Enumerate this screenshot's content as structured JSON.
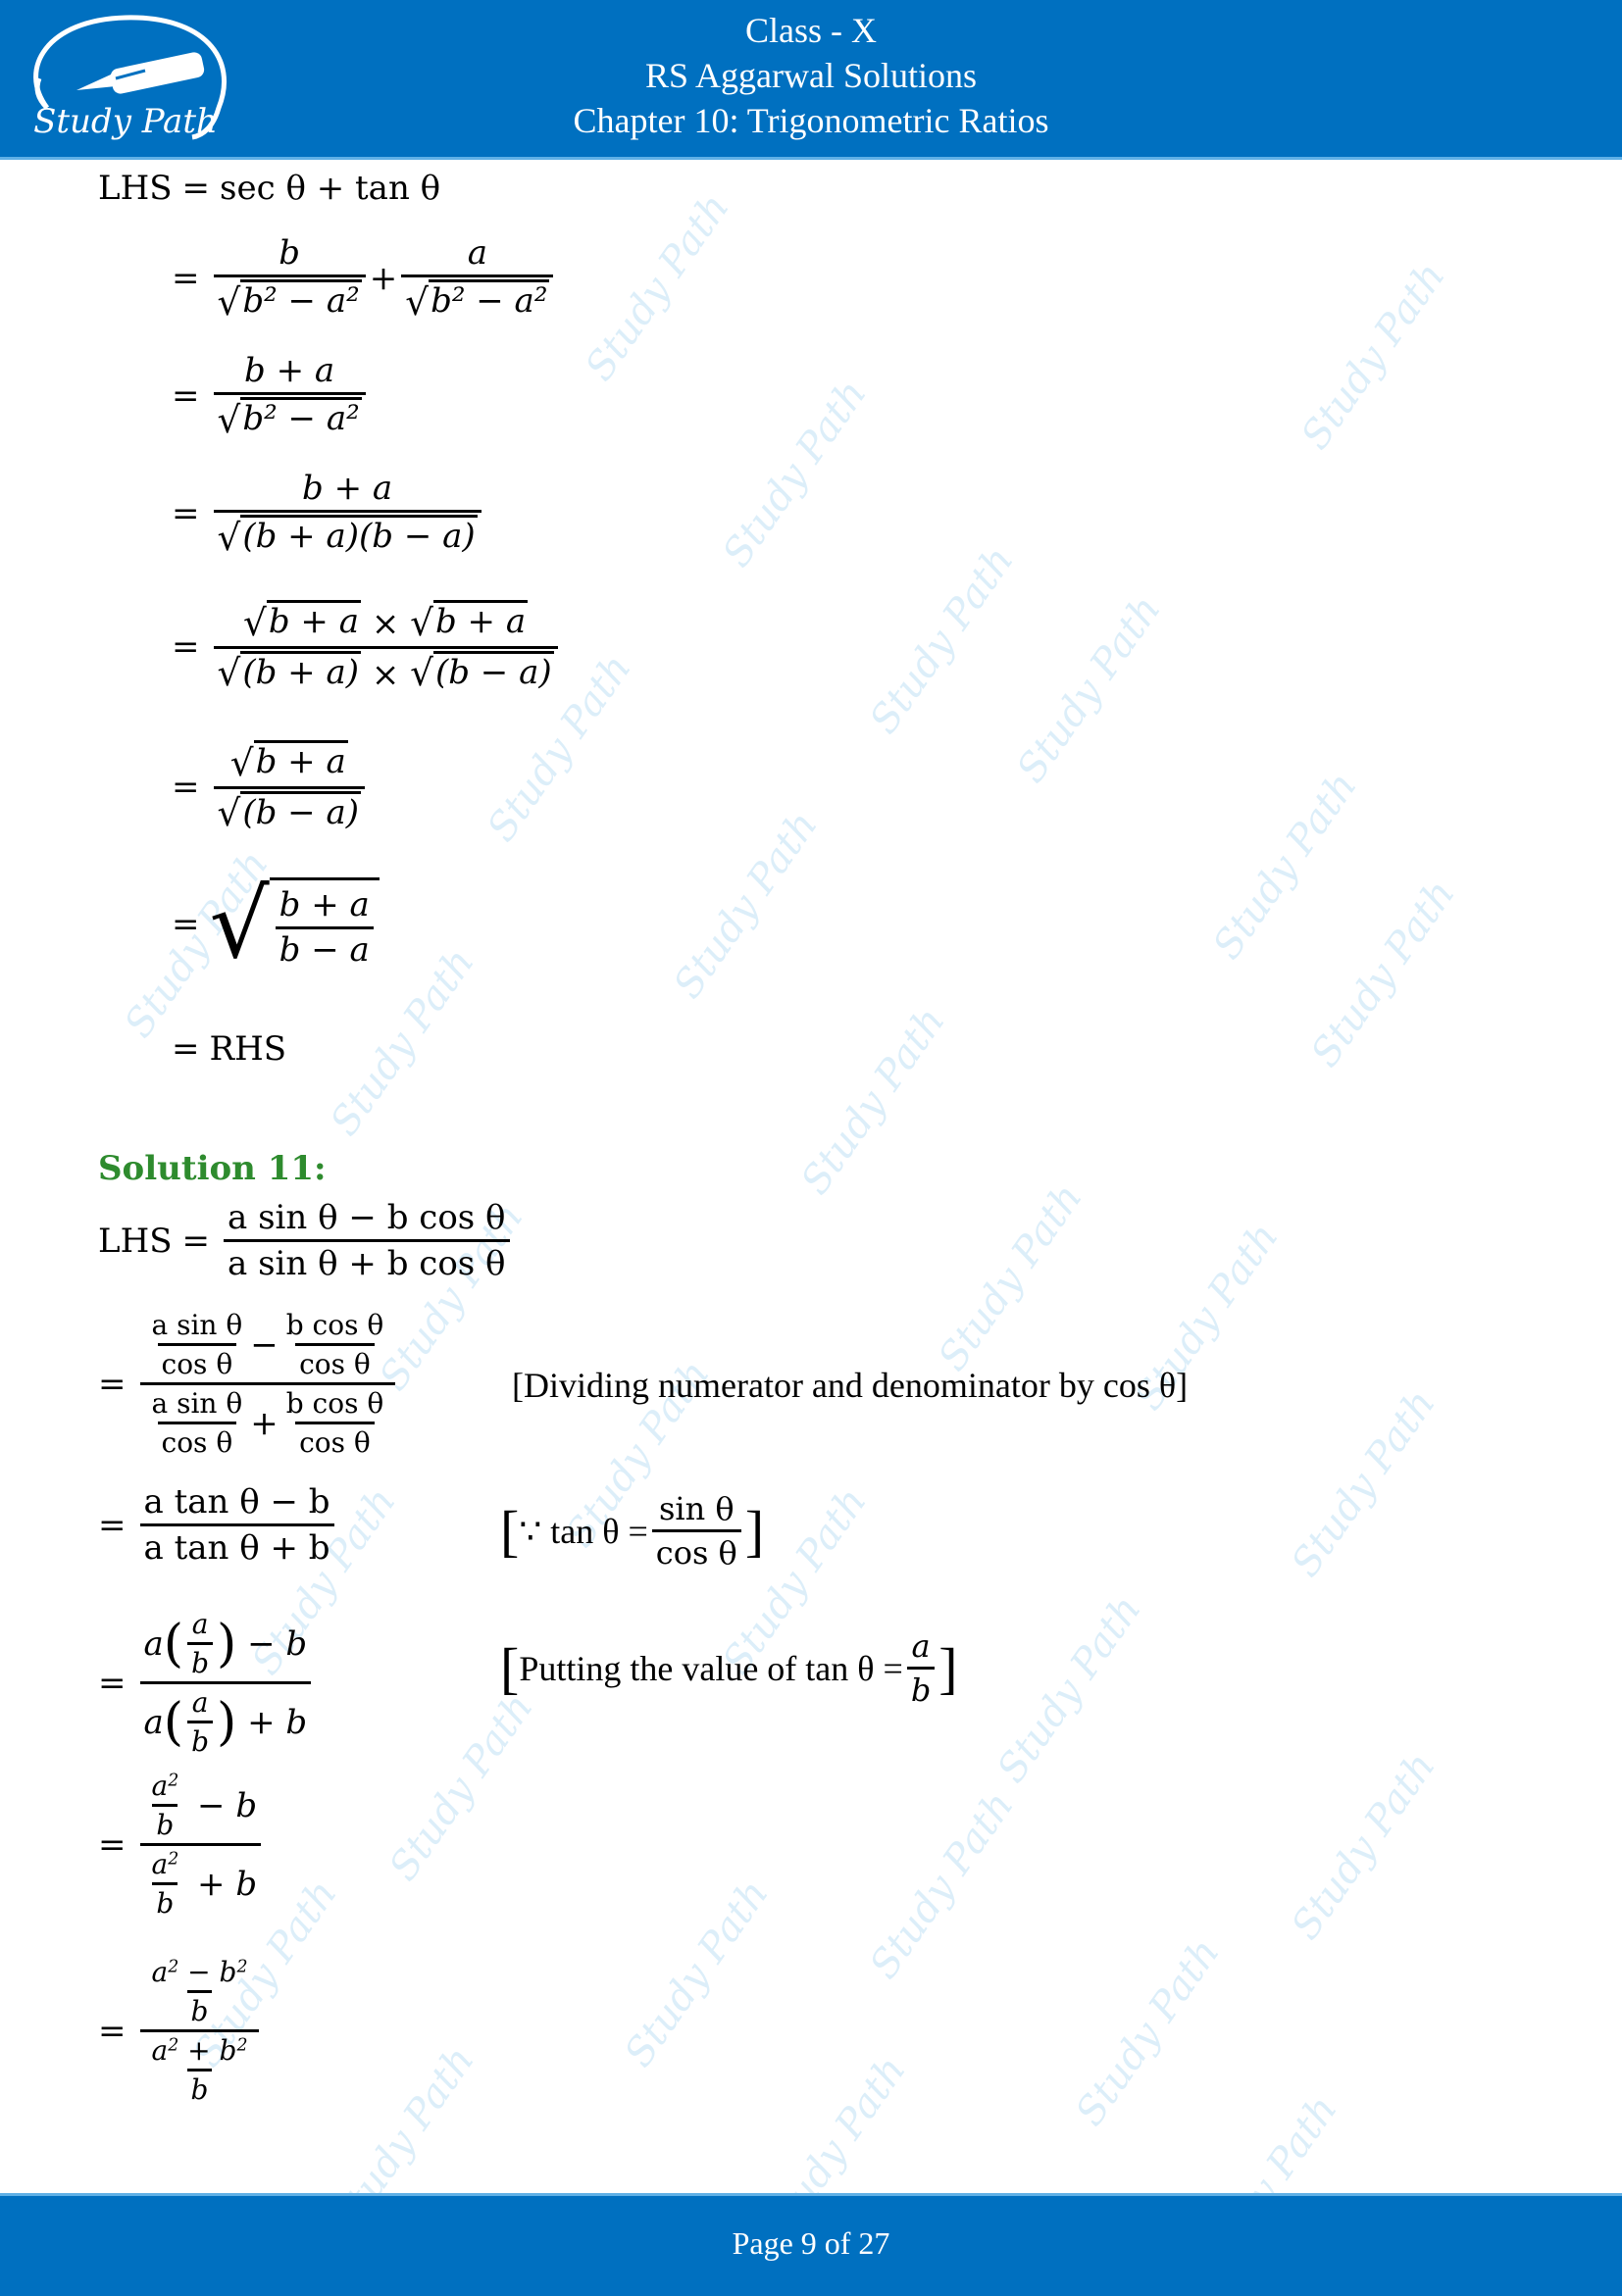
{
  "header": {
    "logo_text": "Study Path",
    "class_label": "Class - X",
    "book_title": "RS Aggarwal Solutions",
    "chapter_title": "Chapter 10: Trigonometric Ratios"
  },
  "footer": {
    "page_label": "Page 9 of 27",
    "current_page": 9,
    "total_pages": 27
  },
  "watermark": {
    "text": "Study Path",
    "color": "#d6ecf9"
  },
  "colors": {
    "header_bg": "#0070c0",
    "solution_heading": "#2e8b2e"
  },
  "solution10_continued": {
    "lhs_label": "LHS",
    "rhs_label": "RHS",
    "steps": [
      "LHS = sec θ + tan θ",
      "= b/√(b² − a²) + a/√(b² − a²)",
      "= (b + a)/√(b² − a²)",
      "= (b + a)/√((b + a)(b − a))",
      "= (√(b + a) × √(b + a))/(√(b + a) × √(b − a))",
      "= √(b + a)/√(b − a)",
      "= √((b + a)/(b − a))",
      "= RHS"
    ],
    "text": {
      "lhs_def": "sec θ + tan θ",
      "s1_n1": "b",
      "s1_n2": "a",
      "s1_den": "b² − a²",
      "s2_num": "b + a",
      "s2_den": "b² − a²",
      "s3_num": "b + a",
      "s3_den": "(b + a)(b − a)",
      "s4_num_a": "b + a",
      "s4_num_b": "b + a",
      "s4_den_a": "(b + a)",
      "s4_den_b": "(b − a)",
      "s5_num": "b + a",
      "s5_den": "(b − a)",
      "s6_num": "b + a",
      "s6_den": "b − a"
    }
  },
  "solution11": {
    "heading": "Solution 11:",
    "steps": [
      "LHS = (a sin θ − b cos θ)/(a sin θ + b cos θ)",
      "= (a sin θ/cos θ − b cos θ/cos θ)/(a sin θ/cos θ + b cos θ/cos θ)",
      "= (a tan θ − b)/(a tan θ + b)",
      "= (a(a/b) − b)/(a(a/b) + b)",
      "= (a²/b − b)/(a²/b + b)",
      "= ((a² − b²)/b)/((a² + b²)/b)"
    ],
    "notes": [
      "[Dividing numerator and denominator by cos θ]",
      "[∵ tan θ = sin θ/cos θ]",
      "[Putting the value of tan θ = a/b]"
    ],
    "text": {
      "lhs_num": "a sin θ − b cos θ",
      "lhs_den": "a sin θ + b cos θ",
      "asin": "a sin θ",
      "bcos": "b cos θ",
      "cos": "cos θ",
      "t_num": "a tan θ − b",
      "t_den": "a tan θ + b",
      "note1": "[Dividing numerator and denominator by cos θ]",
      "note2_prefix": "∵ tan θ =",
      "note2_num": "sin θ",
      "note2_den": "cos θ",
      "note3_prefix": "Putting the value of tan θ =",
      "note3_num": "a",
      "note3_den": "b"
    }
  }
}
